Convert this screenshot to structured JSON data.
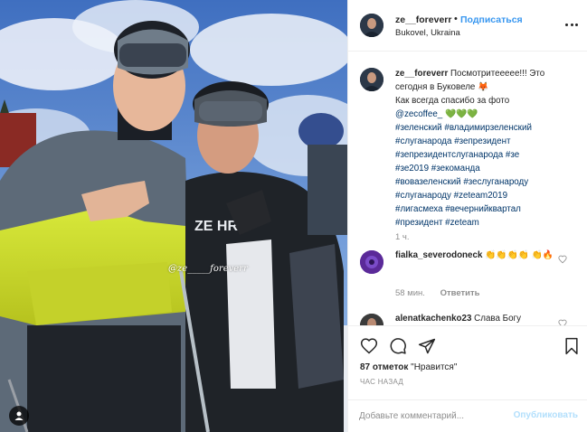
{
  "post": {
    "photo": {
      "watermark": "@ze_____foreverr"
    },
    "header": {
      "username": "ze__foreverr",
      "separator": "•",
      "follow_label": "Подписаться",
      "location": "Bukovel, Ukraina"
    },
    "caption": {
      "username": "ze__foreverr",
      "text": "Посмотрите​ееее!!! Это сегодня в Буковеле 🦊",
      "line2": "Как всегда спасибо за фото",
      "mention": "@zecoffee_",
      "mention_suffix": " 💚💚💚",
      "hashtags": [
        "#зеленский #владимирзеленский",
        "#слуганарода #зепрезидент",
        "#зепрезидентслуганарода #зе",
        "#зе2019 #зекоманда",
        "#вовазеленский #зеслуганароду",
        "#слуганароду #zeteam2019",
        "#лигасмеха #вечернийквартал",
        "#президент #zeteam"
      ],
      "time": "1 ч."
    },
    "comments": [
      {
        "username": "fialka_severodoneck",
        "text": "👏👏👏👏 👏🔥",
        "time": "58 мин.",
        "reply_label": "Ответить"
      },
      {
        "username": "alenatkachenko23",
        "text": "Слава Богу"
      }
    ],
    "likes": {
      "count": "87 отметок",
      "action": "\"Нравится\""
    },
    "date": "час назад",
    "add_comment": {
      "placeholder": "Добавьте комментарий...",
      "publish_label": "Опубликовать"
    },
    "colors": {
      "link_blue": "#3897f0",
      "hashtag": "#003569",
      "muted": "#8e8e8e",
      "publish_disabled": "#b2dffc"
    }
  }
}
